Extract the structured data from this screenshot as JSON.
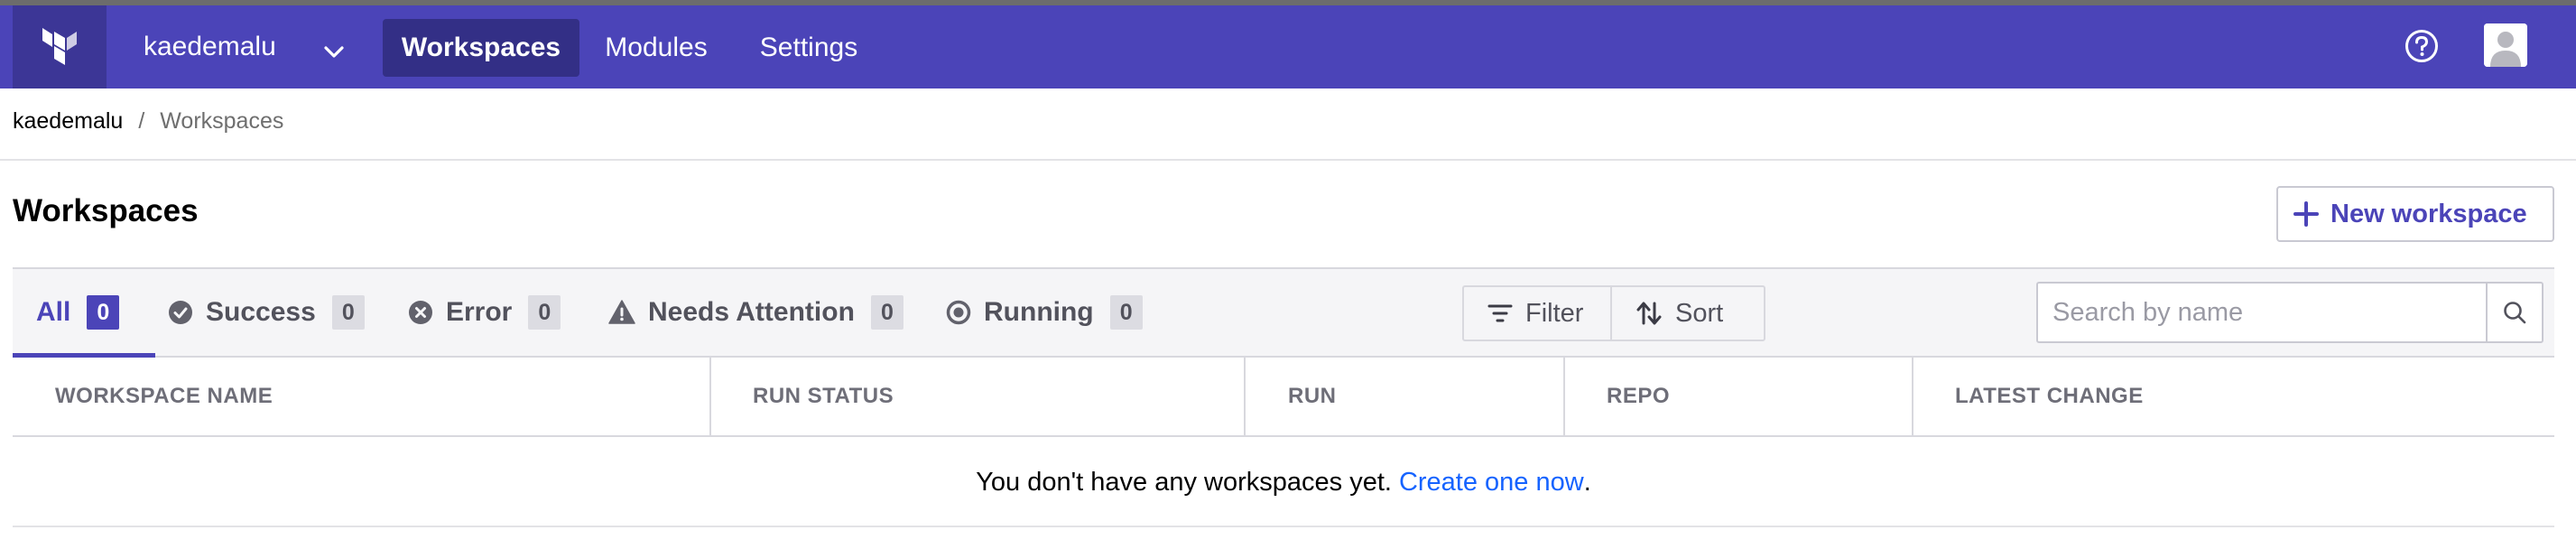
{
  "nav": {
    "logo_icon": "terraform-logo-icon",
    "org_name": "kaedemalu",
    "items": [
      {
        "label": "Workspaces",
        "active": true
      },
      {
        "label": "Modules",
        "active": false
      },
      {
        "label": "Settings",
        "active": false
      }
    ],
    "help_icon": "help-circle-icon",
    "avatar_icon": "user-avatar-icon",
    "bg_color": "#4b44b8"
  },
  "breadcrumb": {
    "org": "kaedemalu",
    "separator": "/",
    "current": "Workspaces"
  },
  "page": {
    "title": "Workspaces",
    "new_button_label": "New workspace"
  },
  "filters": {
    "tabs": [
      {
        "label": "All",
        "count": "0",
        "icon": "",
        "active": true
      },
      {
        "label": "Success",
        "count": "0",
        "icon": "check-circle-icon",
        "active": false
      },
      {
        "label": "Error",
        "count": "0",
        "icon": "x-circle-icon",
        "active": false
      },
      {
        "label": "Needs Attention",
        "count": "0",
        "icon": "warning-triangle-icon",
        "active": false
      },
      {
        "label": "Running",
        "count": "0",
        "icon": "running-circle-icon",
        "active": false
      }
    ],
    "filter_label": "Filter",
    "sort_label": "Sort",
    "search_placeholder": "Search by name",
    "search_value": ""
  },
  "table": {
    "columns": [
      "WORKSPACE NAME",
      "RUN STATUS",
      "RUN",
      "REPO",
      "LATEST CHANGE"
    ],
    "empty_message": "You don't have any workspaces yet.",
    "empty_link": "Create one now",
    "empty_suffix": "."
  }
}
